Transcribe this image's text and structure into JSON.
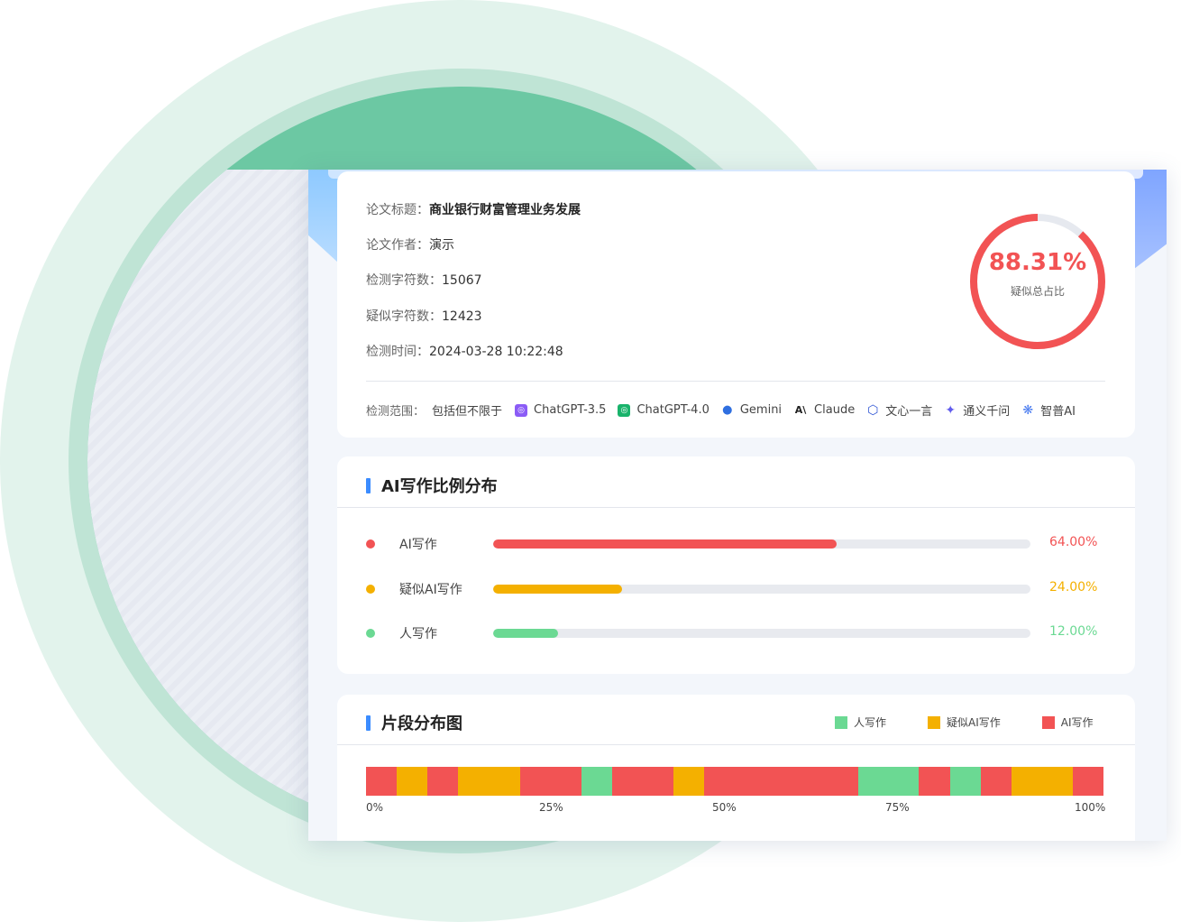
{
  "colors": {
    "ai": "#f25354",
    "suspect": "#f4b000",
    "human": "#6bd993",
    "accent": "#3b8cff"
  },
  "paper": {
    "title_label": "论文标题：",
    "title": "商业银行财富管理业务发展",
    "author_label": "论文作者：",
    "author": "演示",
    "chars_label": "检测字符数：",
    "chars": "15067",
    "suspect_label": "疑似字符数：",
    "suspect": "12423",
    "time_label": "检测时间：",
    "time": "2024-03-28 10:22:48"
  },
  "ratio": {
    "value": "88.31%",
    "fraction": 0.8831,
    "label": "疑似总占比"
  },
  "scope": {
    "label": "检测范围：",
    "lead": "包括但不限于",
    "models": [
      {
        "name": "ChatGPT-3.5",
        "icon": "chatgpt-icon",
        "color": "#8b5cf6"
      },
      {
        "name": "ChatGPT-4.0",
        "icon": "chatgpt-icon",
        "color": "#19b36b"
      },
      {
        "name": "Gemini",
        "icon": "gemini-icon",
        "color": "#2f6fe0"
      },
      {
        "name": "Claude",
        "icon": "claude-icon",
        "color": "#222222"
      },
      {
        "name": "文心一言",
        "icon": "wenxin-icon",
        "color": "#2f55d4"
      },
      {
        "name": "通义千问",
        "icon": "tongyi-icon",
        "color": "#615ced"
      },
      {
        "name": "智普AI",
        "icon": "zhipu-icon",
        "color": "#4a7cf0"
      }
    ]
  },
  "distribution": {
    "title": "AI写作比例分布",
    "rows": [
      {
        "label": "AI写作",
        "value": "64.00%",
        "fraction": 0.64,
        "color": "#f25354"
      },
      {
        "label": "疑似AI写作",
        "value": "24.00%",
        "fraction": 0.24,
        "color": "#f4b000"
      },
      {
        "label": "人写作",
        "value": "12.00%",
        "fraction": 0.12,
        "color": "#6bd993"
      }
    ]
  },
  "segments": {
    "title": "片段分布图",
    "legend": [
      {
        "label": "人写作",
        "color": "#6bd993"
      },
      {
        "label": "疑似AI写作",
        "color": "#f4b000"
      },
      {
        "label": "AI写作",
        "color": "#f25354"
      }
    ],
    "ticks": [
      "0%",
      "25%",
      "50%",
      "75%",
      "100%"
    ],
    "blocks": [
      {
        "type": "ai",
        "share": 0.041
      },
      {
        "type": "suspect",
        "share": 0.042
      },
      {
        "type": "ai",
        "share": 0.042
      },
      {
        "type": "suspect",
        "share": 0.084
      },
      {
        "type": "ai",
        "share": 0.083
      },
      {
        "type": "human",
        "share": 0.042
      },
      {
        "type": "ai",
        "share": 0.083
      },
      {
        "type": "suspect",
        "share": 0.042
      },
      {
        "type": "ai",
        "share": 0.208
      },
      {
        "type": "human",
        "share": 0.083
      },
      {
        "type": "ai",
        "share": 0.042
      },
      {
        "type": "human",
        "share": 0.042
      },
      {
        "type": "ai",
        "share": 0.041
      },
      {
        "type": "suspect",
        "share": 0.084
      },
      {
        "type": "ai",
        "share": 0.041
      }
    ]
  }
}
